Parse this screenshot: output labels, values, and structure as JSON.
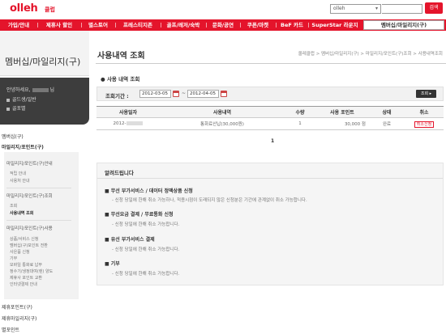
{
  "header": {
    "logo": "olleh",
    "logo_sub": "클럽",
    "search_select": "olleh",
    "search_button": "검색"
  },
  "gnb": [
    {
      "label": "가입/안내"
    },
    {
      "label": "제휴사 할인"
    },
    {
      "label": "별스토어"
    },
    {
      "label": "프레스티지존"
    },
    {
      "label": "골프/레저/숙박"
    },
    {
      "label": "문화/공연"
    },
    {
      "label": "쿠폰/마켓"
    },
    {
      "label": "BeF 카드"
    },
    {
      "label": "SuperStar 라운지"
    },
    {
      "label": "멤버십/마일리지(구)"
    }
  ],
  "sidebar": {
    "title": "멤버십/마일리지(구)",
    "user": {
      "greeting_prefix": "안녕하세요,",
      "greeting_suffix": "님",
      "grade": "골드생/일반",
      "points": "골포별"
    },
    "menu": {
      "membership": "멤버십(구)",
      "mileage": "마일리지/포인트(구)",
      "group1_title": "마일리지/포인트(구)안내",
      "group1_items": [
        "적립 안내",
        "사용처 안내"
      ],
      "group2_title": "마일리지/포인트(구)조회",
      "group2_items": [
        "조회",
        "사용내역 조회"
      ],
      "group3_title": "마일리지/포인트(구)사용",
      "group3_items": [
        "상품/서비스 신청",
        "멤버십(구)포인트 전환",
        "사은품 신청",
        "기부",
        "모바일 통화료 납부",
        "정수기/냉정대여(렌) 양도",
        "제휴사 포인트 교환",
        "인터넷결제 안내"
      ],
      "partner_points": "제휴포인트(구)",
      "partner_mileage": "제휴마일리지(구)",
      "star_point": "별포인트"
    }
  },
  "main": {
    "page_title": "사용내역 조회",
    "breadcrumb": "올레클럽 > 멤버십/마일리지(구) > 마일리지/포인트(구)조회 > 사용내역조회",
    "section_title": "사용 내역 조회",
    "period_label": "조회기간 :",
    "date_from": "2012-03-05",
    "date_to": "2012-04-05",
    "tilde": "~",
    "query_button": "조회 ▸",
    "table": {
      "headers": [
        "사용일자",
        "사용내역",
        "수량",
        "사용 포인트",
        "상태",
        "취소"
      ],
      "rows": [
        {
          "date": "2012-",
          "desc": "통화료산납(30,000원)",
          "qty": "1",
          "points": "30,000 점",
          "status": "완료",
          "cancel": "취소신청"
        }
      ]
    },
    "pager": "1",
    "notice": {
      "title": "알려드립니다",
      "items": [
        {
          "head": "■ 무선 부가서비스 / 데이터 정액상품 신청",
          "desc": "- 신청 당일에 한해 취소 가능하나, 적용시점이 도래되지 않은 신청분은 기간에 관계없이 취소 가능합니다."
        },
        {
          "head": "■ 무선요금 결제 / 무료통화 신청",
          "desc": "- 신청 당일에 한해 취소 가능합니다."
        },
        {
          "head": "■ 유선 부가서비스 결제",
          "desc": "- 신청 당일에 한해 취소 가능합니다."
        },
        {
          "head": "■ 기부",
          "desc": "- 신청 당일에 한해 취소 가능합니다."
        }
      ]
    }
  },
  "colors": {
    "brand_red": "#e4142b",
    "sidebar_dark": "#3d3d3d"
  }
}
